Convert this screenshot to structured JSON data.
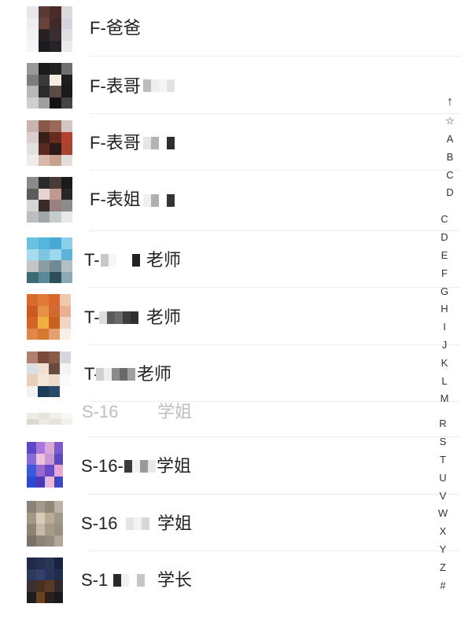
{
  "contacts": [
    {
      "name": "F-爸爸"
    },
    {
      "name": "F-表哥"
    },
    {
      "name": "F-表哥"
    },
    {
      "name": "F-表姐"
    },
    {
      "name": "T-",
      "name_suffix": "老师"
    },
    {
      "name": "T-",
      "name_suffix": "老师"
    },
    {
      "name": "T-",
      "name_suffix": "老师"
    },
    {
      "name": "S-16",
      "name_suffix": "学姐"
    },
    {
      "name": "S-16-",
      "name_suffix": "学姐"
    },
    {
      "name": "S-16",
      "name_suffix": "学姐"
    },
    {
      "name": "S-1",
      "name_suffix": "学长"
    }
  ],
  "index_bar": {
    "top_arrow": "↑",
    "star": "☆",
    "letters": [
      "A",
      "B",
      "C",
      "D",
      "C",
      "D",
      "E",
      "F",
      "G",
      "H",
      "I",
      "J",
      "K",
      "L",
      "M",
      "R",
      "S",
      "T",
      "U",
      "V",
      "W",
      "X",
      "Y",
      "Z",
      "#"
    ]
  }
}
